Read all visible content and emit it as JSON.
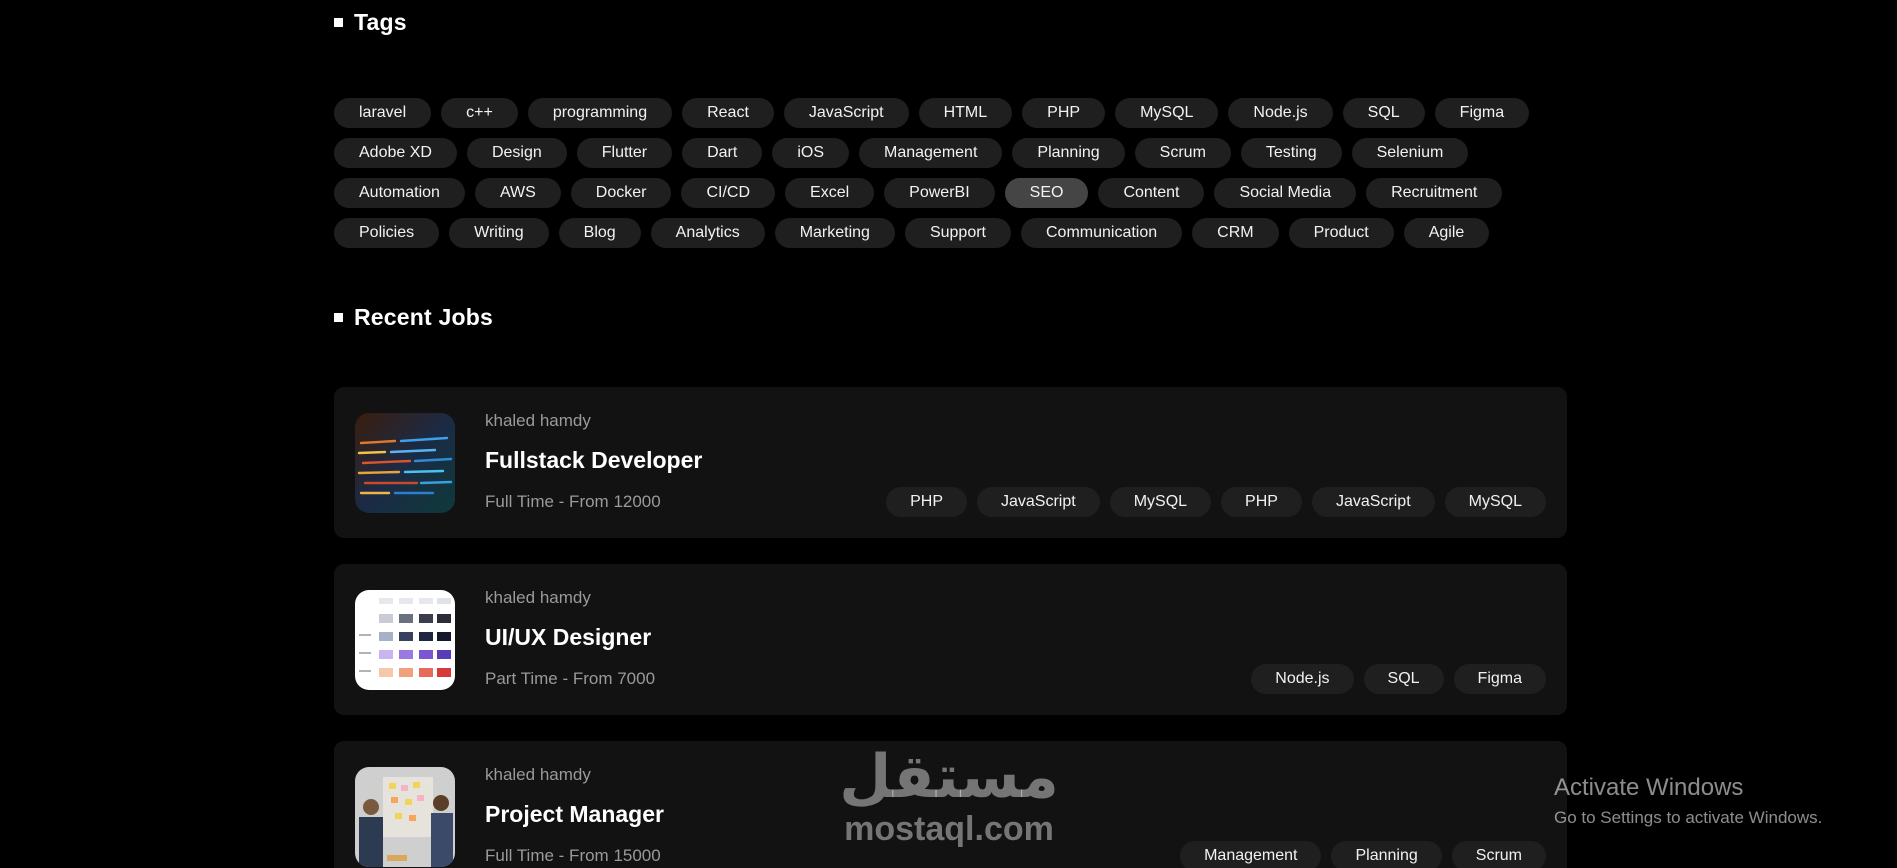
{
  "sections": {
    "tags_title": "Tags",
    "jobs_title": "Recent Jobs"
  },
  "tags": [
    "laravel",
    "c++",
    "programming",
    "React",
    "JavaScript",
    "HTML",
    "PHP",
    "MySQL",
    "Node.js",
    "SQL",
    "Figma",
    "Adobe XD",
    "Design",
    "Flutter",
    "Dart",
    "iOS",
    "Management",
    "Planning",
    "Scrum",
    "Testing",
    "Selenium",
    "Automation",
    "AWS",
    "Docker",
    "CI/CD",
    "Excel",
    "PowerBI",
    "SEO",
    "Content",
    "Social Media",
    "Recruitment",
    "Policies",
    "Writing",
    "Blog",
    "Analytics",
    "Marketing",
    "Support",
    "Communication",
    "CRM",
    "Product",
    "Agile"
  ],
  "active_tag": "SEO",
  "jobs": [
    {
      "company": "khaled hamdy",
      "title": "Fullstack Developer",
      "meta": "Full Time - From 12000",
      "thumb": "code-screen-thumbnail",
      "tags": [
        "PHP",
        "JavaScript",
        "MySQL",
        "PHP",
        "JavaScript",
        "MySQL"
      ]
    },
    {
      "company": "khaled hamdy",
      "title": "UI/UX Designer",
      "meta": "Part Time - From 7000",
      "thumb": "ui-palette-thumbnail",
      "tags": [
        "Node.js",
        "SQL",
        "Figma"
      ]
    },
    {
      "company": "khaled hamdy",
      "title": "Project Manager",
      "meta": "Full Time - From 15000",
      "thumb": "team-board-thumbnail",
      "tags": [
        "Management",
        "Planning",
        "Scrum"
      ]
    }
  ],
  "watermark": {
    "arabic": "مستقل",
    "latin": "mostaql.com"
  },
  "windows_notice": {
    "title": "Activate Windows",
    "subtitle": "Go to Settings to activate Windows."
  },
  "colors": {
    "background": "#000000",
    "card": "#121212",
    "tag": "#1f1f1f",
    "tag_active": "#454545",
    "muted_text": "#9a9a9a"
  }
}
